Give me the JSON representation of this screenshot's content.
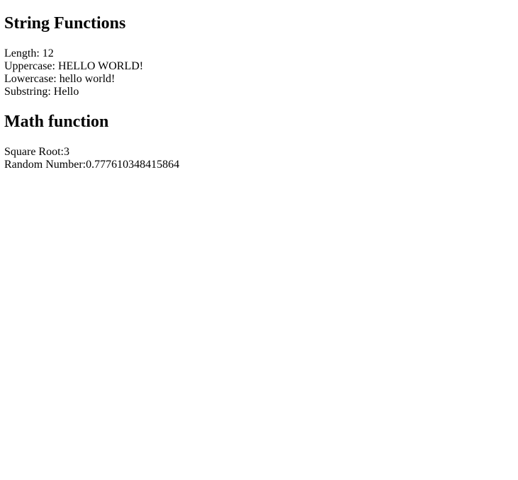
{
  "string_section": {
    "heading": "String Functions",
    "lines": [
      {
        "label": "Length: ",
        "value": "12"
      },
      {
        "label": "Uppercase: ",
        "value": "HELLO WORLD!"
      },
      {
        "label": "Lowercase: ",
        "value": "hello world!"
      },
      {
        "label": "Substring: ",
        "value": "Hello"
      }
    ]
  },
  "math_section": {
    "heading": "Math function",
    "lines": [
      {
        "label": "Square Root:",
        "value": "3"
      },
      {
        "label": "Random Number:",
        "value": "0.777610348415864"
      }
    ]
  }
}
